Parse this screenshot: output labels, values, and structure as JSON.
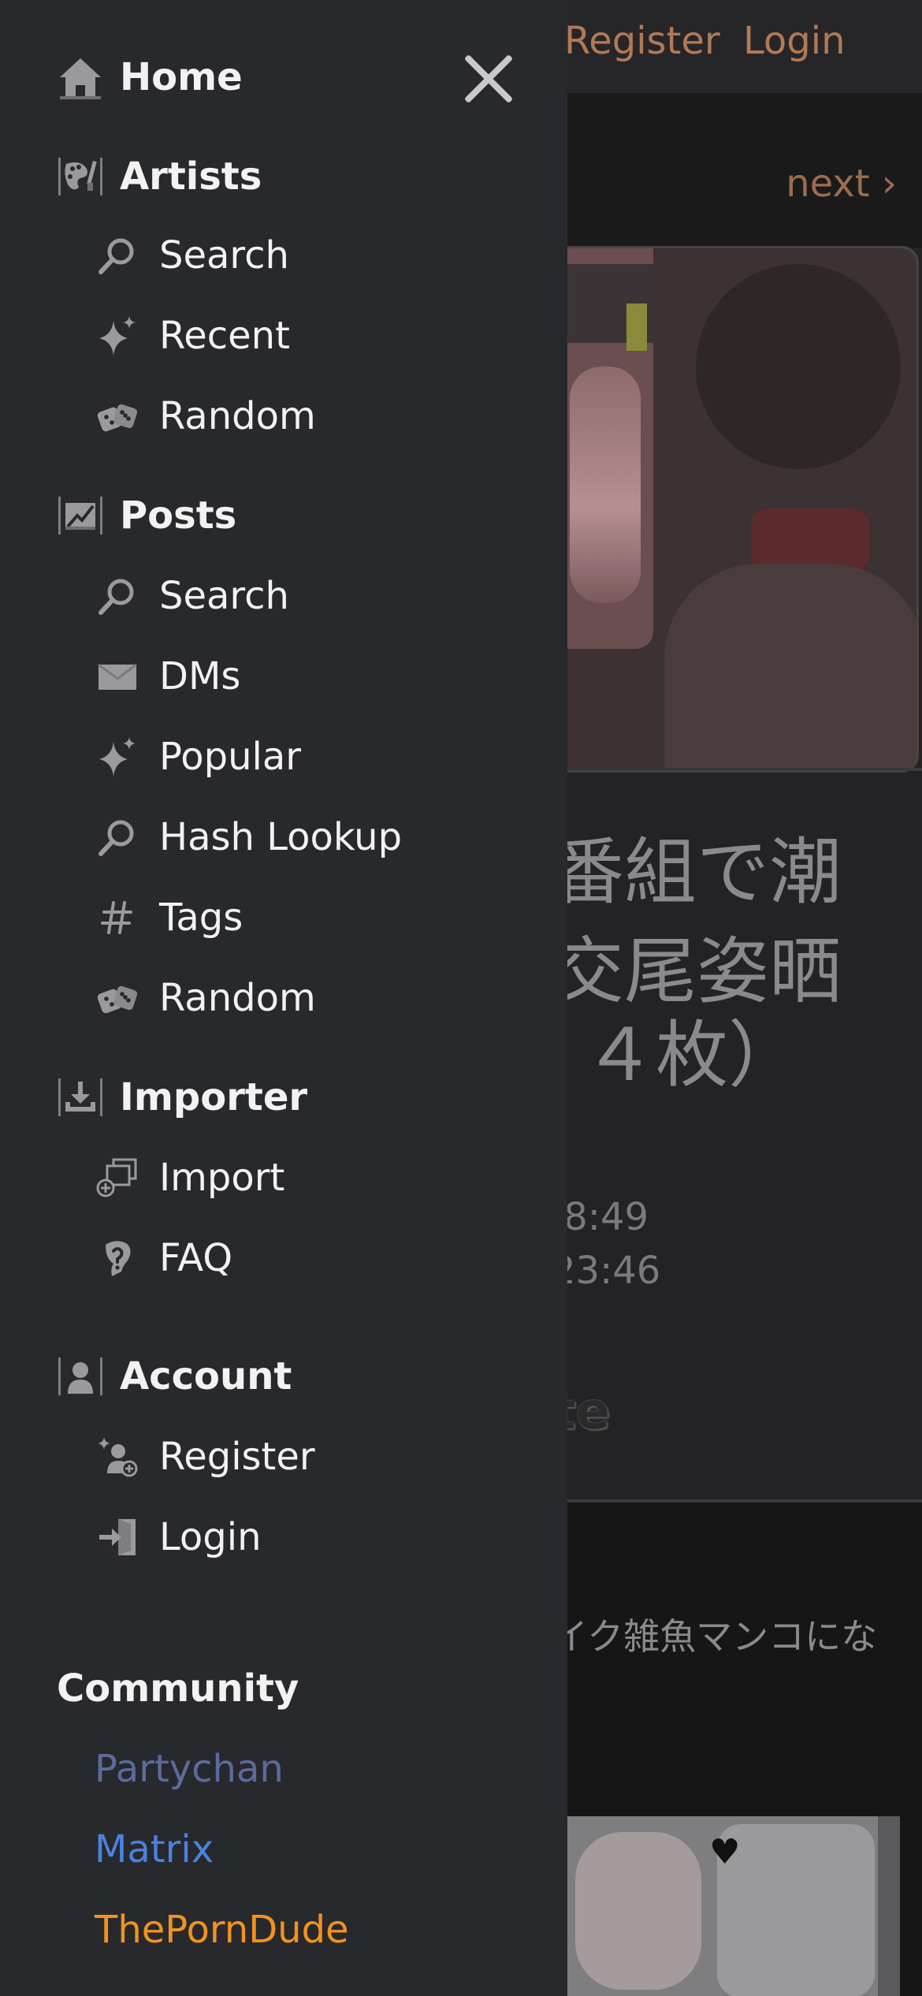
{
  "header": {
    "register_label": "Register",
    "login_label": "Login"
  },
  "post": {
    "next_label": "next ›",
    "title_lines": [
      "番組で潮",
      "交尾姿晒",
      "４枚）"
    ],
    "dates": [
      ".8:49",
      "23:46"
    ],
    "favorite_fragment": "te",
    "content_text": "イク雑魚マンコにな"
  },
  "drawer": {
    "home": {
      "label": "Home",
      "icon": "home-icon"
    },
    "artists": {
      "label": "Artists",
      "icon": "artists-palette-icon",
      "items": [
        {
          "label": "Search",
          "icon": "search-icon"
        },
        {
          "label": "Recent",
          "icon": "sparkle-icon"
        },
        {
          "label": "Random",
          "icon": "dice-icon"
        }
      ]
    },
    "posts": {
      "label": "Posts",
      "icon": "posts-icon",
      "items": [
        {
          "label": "Search",
          "icon": "search-icon"
        },
        {
          "label": "DMs",
          "icon": "envelope-icon"
        },
        {
          "label": "Popular",
          "icon": "sparkle-icon"
        },
        {
          "label": "Hash Lookup",
          "icon": "search-icon"
        },
        {
          "label": "Tags",
          "icon": "hash-icon"
        },
        {
          "label": "Random",
          "icon": "dice-icon"
        }
      ]
    },
    "importer": {
      "label": "Importer",
      "icon": "importer-icon",
      "items": [
        {
          "label": "Import",
          "icon": "import-icon"
        },
        {
          "label": "FAQ",
          "icon": "faq-icon"
        }
      ]
    },
    "account": {
      "label": "Account",
      "icon": "account-icon",
      "items": [
        {
          "label": "Register",
          "icon": "register-icon"
        },
        {
          "label": "Login",
          "icon": "login-icon"
        }
      ]
    },
    "community": {
      "title": "Community",
      "links": [
        {
          "label": "Partychan",
          "color": "#5c6b9c"
        },
        {
          "label": "Matrix",
          "color": "#4a82e0"
        },
        {
          "label": "ThePornDude",
          "color": "#f0931f"
        }
      ]
    }
  },
  "colors": {
    "drawer_bg": "#27292d",
    "accent_link": "#b07a55",
    "icon_gray": "#9a9a9c"
  }
}
